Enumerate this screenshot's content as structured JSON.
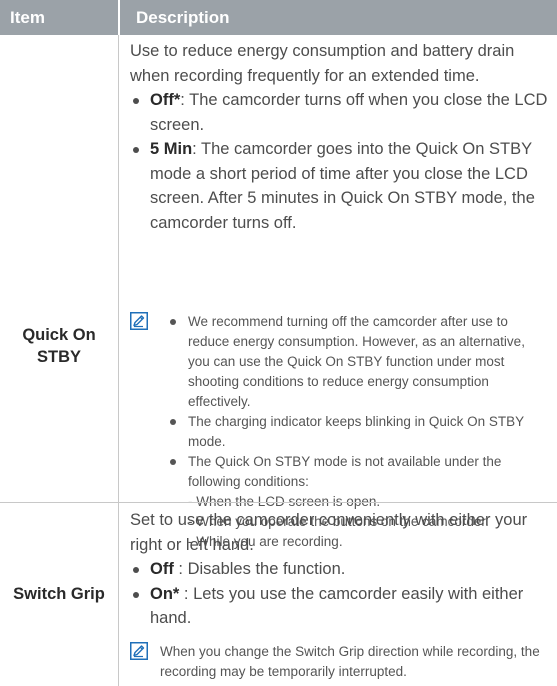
{
  "header": {
    "item": "Item",
    "description": "Description"
  },
  "rows": {
    "quick_on_stby": {
      "label_line1": "Quick On",
      "label_line2": "STBY",
      "intro": "Use to reduce energy consumption and battery drain when recording frequently for an extended time.",
      "bullets": [
        {
          "term": "Off*",
          "text": ": The camcorder turns off when you close the LCD screen."
        },
        {
          "term": "5 Min",
          "text": ": The camcorder goes into the Quick On STBY mode a short period of time after you close the LCD screen. After 5 minutes in Quick On STBY mode, the camcorder turns off."
        }
      ],
      "note_icon": "note-pencil-icon",
      "notes": [
        "We recommend turning off the camcorder after use to reduce energy consumption. However, as an alternative, you can use the Quick On STBY function under most shooting conditions to reduce energy consumption effectively.",
        "The charging indicator keeps blinking in Quick On STBY mode.",
        "The Quick On STBY mode is not available under the following conditions:"
      ],
      "conditions": [
        "- When the LCD screen is open.",
        "- When you operate the buttons on the camcorder.",
        "- While you are recording."
      ]
    },
    "switch_grip": {
      "label": "Switch Grip",
      "intro": "Set to use the camcorder conveniently with either your right or left hand.",
      "bullets": [
        {
          "term": "Off",
          "text": " : Disables the function."
        },
        {
          "term": "On*",
          "text": " : Lets you use the camcorder easily with either hand."
        }
      ],
      "note_icon": "note-pencil-icon",
      "note": "When you change the Switch Grip direction while recording, the recording may be temporarily interrupted."
    }
  },
  "colors": {
    "header_bg": "#9ba2a8",
    "note_icon_blue": "#1f6fb8",
    "grid": "#c8c8c8"
  }
}
